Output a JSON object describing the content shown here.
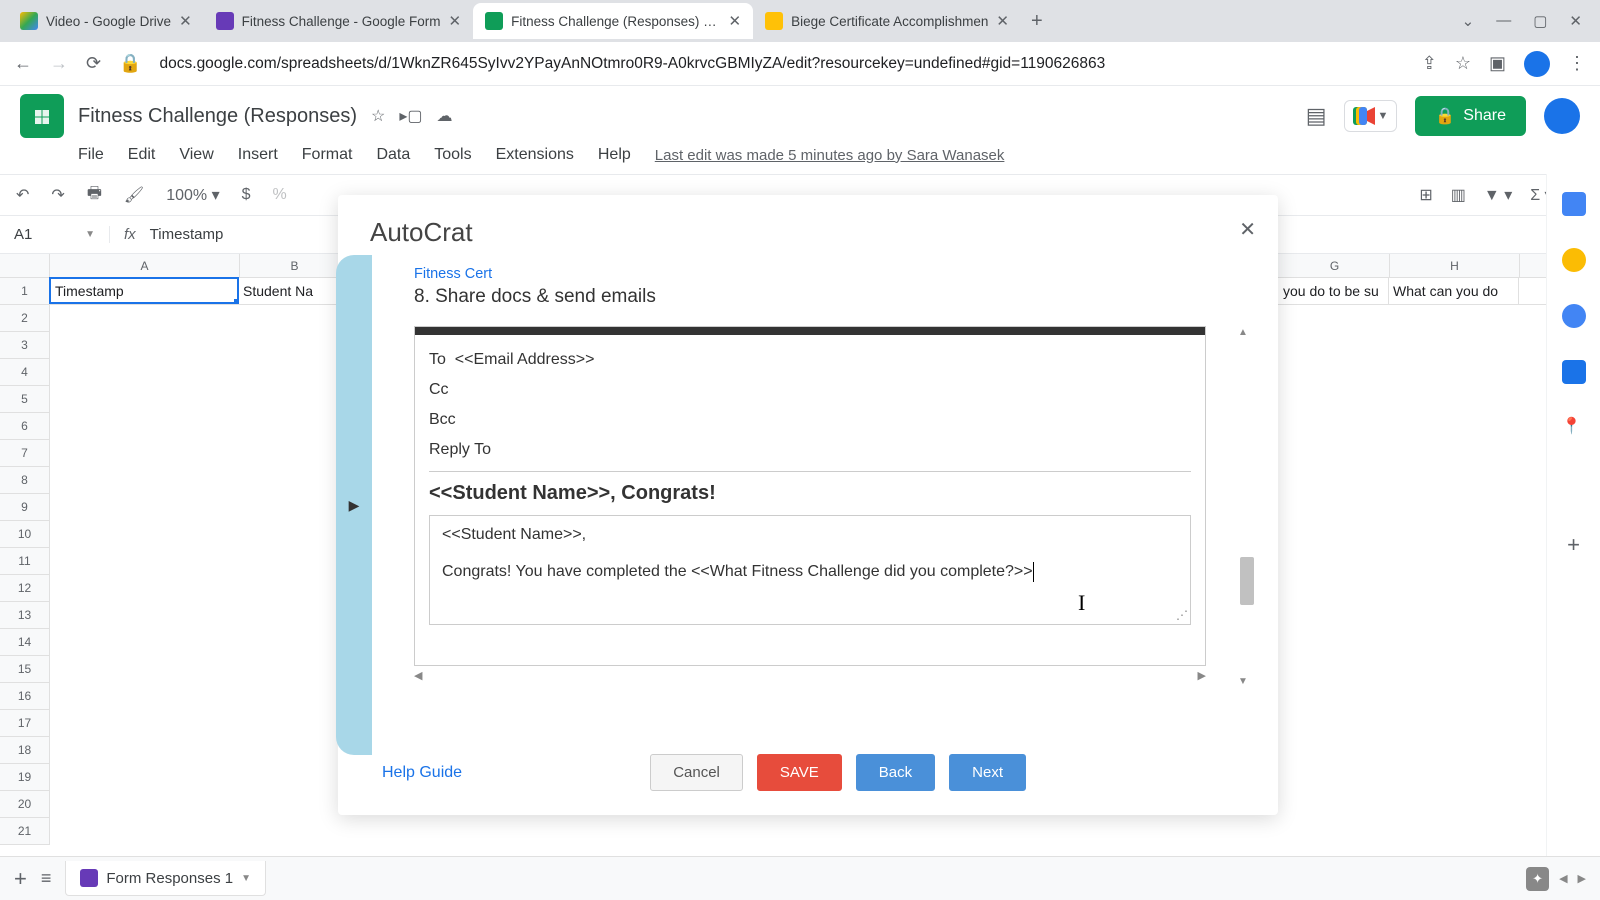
{
  "browser": {
    "tabs": [
      {
        "title": "Video - Google Drive",
        "icon_color": "#0f9d58"
      },
      {
        "title": "Fitness Challenge - Google Form",
        "icon_color": "#673ab7"
      },
      {
        "title": "Fitness Challenge (Responses) - G",
        "icon_color": "#0f9d58",
        "active": true
      },
      {
        "title": "Biege Certificate Accomplishmen",
        "icon_color": "#ffc107"
      }
    ],
    "url": "docs.google.com/spreadsheets/d/1WknZR645SyIvv2YPayAnNOtmro0R9-A0krvcGBMIyZA/edit?resourcekey=undefined#gid=1190626863"
  },
  "sheets": {
    "doc_title": "Fitness Challenge  (Responses)",
    "menus": [
      "File",
      "Edit",
      "View",
      "Insert",
      "Format",
      "Data",
      "Tools",
      "Extensions",
      "Help"
    ],
    "last_edit": "Last edit was made 5 minutes ago by Sara Wanasek",
    "zoom": "100%",
    "share_label": "Share",
    "active_cell": "A1",
    "formula_value": "Timestamp",
    "columns": [
      "A",
      "B",
      "G",
      "H"
    ],
    "row1": {
      "A": "Timestamp",
      "B": "Student Na",
      "G": "you do to be su",
      "H": "What can you do"
    },
    "sheet_tab": "Form Responses 1"
  },
  "modal": {
    "title": "AutoCrat",
    "breadcrumb": "Fitness Cert",
    "step_heading": "8. Share docs & send emails",
    "email": {
      "to_label": "To",
      "to_value": "<<Email Address>>",
      "cc_label": "Cc",
      "bcc_label": "Bcc",
      "reply_label": "Reply To",
      "subject": "<<Student Name>>, Congrats!",
      "body_line1": "<<Student Name>>,",
      "body_line2": "Congrats! You have completed the <<What Fitness Challenge did you complete?>>"
    },
    "help_link": "Help Guide",
    "buttons": {
      "cancel": "Cancel",
      "save": "SAVE",
      "back": "Back",
      "next": "Next"
    }
  }
}
